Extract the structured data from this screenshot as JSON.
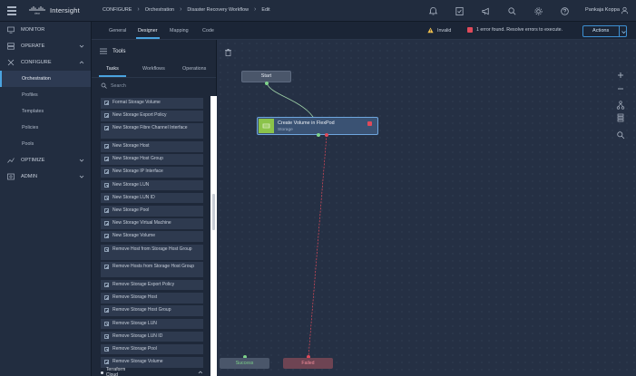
{
  "app": {
    "brand": "Intersight",
    "user": "Pankaja Koppa"
  },
  "breadcrumb": [
    "CONFIGURE",
    "Orchestration",
    "Disaster Recovery Workflow",
    "Edit"
  ],
  "sidebar": {
    "items": [
      {
        "label": "MONITOR",
        "icon": "monitor-icon"
      },
      {
        "label": "OPERATE",
        "icon": "operate-icon"
      },
      {
        "label": "CONFIGURE",
        "icon": "configure-icon"
      },
      {
        "label": "Orchestration"
      },
      {
        "label": "Profiles"
      },
      {
        "label": "Templates"
      },
      {
        "label": "Policies"
      },
      {
        "label": "Pools"
      },
      {
        "label": "OPTIMIZE",
        "icon": "optimize-icon"
      },
      {
        "label": "ADMIN",
        "icon": "admin-icon"
      }
    ]
  },
  "tabs": [
    "General",
    "Designer",
    "Mapping",
    "Code"
  ],
  "status": {
    "invalid": "Invalid",
    "error": "1 error found. Resolve errors to execute."
  },
  "actions_label": "Actions",
  "tools": {
    "title": "Tools",
    "tabs": [
      "Tasks",
      "Workflows",
      "Operations"
    ],
    "search_placeholder": "Search",
    "tasks": [
      "Format Storage Volume",
      "New Storage Export Policy",
      "New Storage Fibre Channel Interface",
      "New Storage Host",
      "New Storage Host Group",
      "New Storage IP Interface",
      "New Storage LUN",
      "New Storage LUN ID",
      "New Storage Pool",
      "New Storage Virtual Machine",
      "New Storage Volume",
      "Remove Host from Storage Host Group",
      "Remove Hosts from Storage Host Group",
      "Remove Storage Export Policy",
      "Remove Storage Host",
      "Remove Storage Host Group",
      "Remove Storage LUN",
      "Remove Storage LUN ID",
      "Remove Storage Pool",
      "Remove Storage Volume"
    ],
    "section": "Terraform Cloud"
  },
  "canvas": {
    "start": "Start",
    "node_title": "Create Volume in FlexPod",
    "node_sub": "Storage",
    "success": "Success",
    "failed": "Failed"
  },
  "colors": {
    "accent": "#4aa3df",
    "success": "#7ed38a",
    "failed": "#e04a5a",
    "warning": "#f2c14e"
  }
}
